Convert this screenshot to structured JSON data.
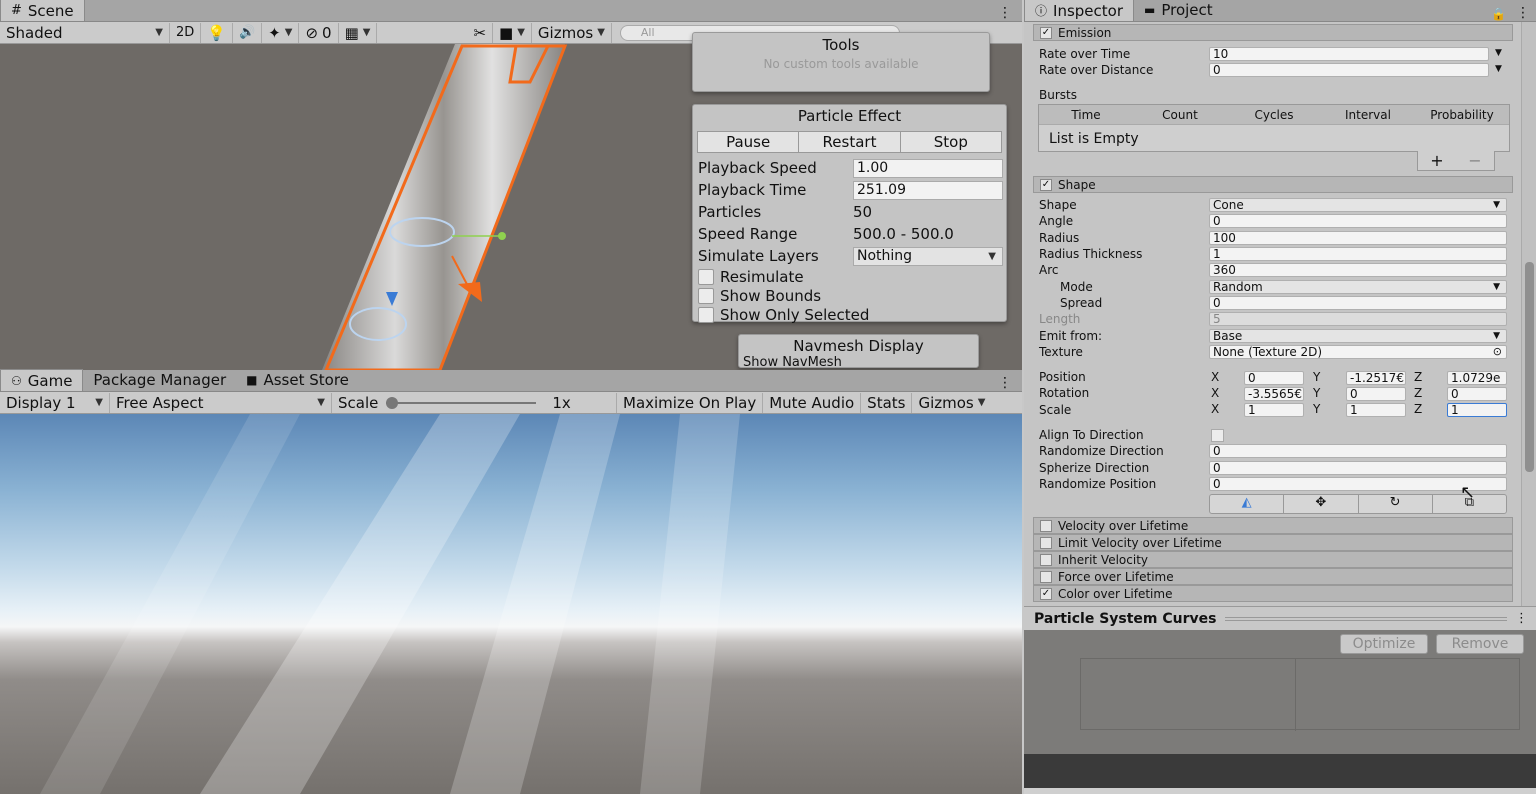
{
  "scene": {
    "tab_label": "Scene",
    "shading_mode": "Shaded",
    "btn_2d": "2D",
    "hidden_count": "0",
    "gizmos_label": "Gizmos",
    "search_placeholder": "All"
  },
  "tools_overlay": {
    "title": "Tools",
    "message": "No custom tools available"
  },
  "particle_effect": {
    "title": "Particle Effect",
    "buttons": {
      "pause": "Pause",
      "restart": "Restart",
      "stop": "Stop"
    },
    "playback_speed_label": "Playback Speed",
    "playback_speed": "1.00",
    "playback_time_label": "Playback Time",
    "playback_time": "251.09",
    "particles_label": "Particles",
    "particles": "50",
    "speed_range_label": "Speed Range",
    "speed_range": "500.0 - 500.0",
    "simulate_layers_label": "Simulate Layers",
    "simulate_layers": "Nothing",
    "resimulate_label": "Resimulate",
    "show_bounds_label": "Show Bounds",
    "show_only_selected_label": "Show Only Selected"
  },
  "navmesh": {
    "title": "Navmesh Display",
    "row": "Show NavMesh"
  },
  "bottom_tabs": {
    "game": "Game",
    "package_manager": "Package Manager",
    "asset_store": "Asset Store"
  },
  "game_toolbar": {
    "display": "Display 1",
    "aspect": "Free Aspect",
    "scale_label": "Scale",
    "scale_value": "1x",
    "scale_fraction": 0.0,
    "maximize": "Maximize On Play",
    "mute": "Mute Audio",
    "stats": "Stats",
    "gizmos": "Gizmos"
  },
  "inspector_tabs": {
    "inspector": "Inspector",
    "project": "Project"
  },
  "emission": {
    "header": "Emission",
    "rate_over_time_label": "Rate over Time",
    "rate_over_time": "10",
    "rate_over_distance_label": "Rate over Distance",
    "rate_over_distance": "0",
    "bursts_label": "Bursts",
    "bursts_columns": [
      "Time",
      "Count",
      "Cycles",
      "Interval",
      "Probability"
    ],
    "bursts_empty": "List is Empty"
  },
  "shape": {
    "header": "Shape",
    "shape_label": "Shape",
    "shape": "Cone",
    "angle_label": "Angle",
    "angle": "0",
    "radius_label": "Radius",
    "radius": "100",
    "radius_thickness_label": "Radius Thickness",
    "radius_thickness": "1",
    "arc_label": "Arc",
    "arc": "360",
    "mode_label": "Mode",
    "mode": "Random",
    "spread_label": "Spread",
    "spread": "0",
    "length_label": "Length",
    "length": "5",
    "emit_from_label": "Emit from:",
    "emit_from": "Base",
    "texture_label": "Texture",
    "texture": "None (Texture 2D)",
    "position_label": "Position",
    "position": {
      "x": "0",
      "y": "-1.2517€",
      "z": "1.0729e"
    },
    "rotation_label": "Rotation",
    "rotation": {
      "x": "-3.5565€",
      "y": "0",
      "z": "0"
    },
    "scale_label": "Scale",
    "scale": {
      "x": "1",
      "y": "1",
      "z": "1"
    },
    "axis_x": "X",
    "axis_y": "Y",
    "axis_z": "Z",
    "align_label": "Align To Direction",
    "rand_dir_label": "Randomize Direction",
    "rand_dir": "0",
    "spherize_label": "Spherize Direction",
    "spherize": "0",
    "rand_pos_label": "Randomize Position",
    "rand_pos": "0"
  },
  "modules": [
    {
      "label": "Velocity over Lifetime",
      "enabled": false
    },
    {
      "label": "Limit Velocity over Lifetime",
      "enabled": false
    },
    {
      "label": "Inherit Velocity",
      "enabled": false
    },
    {
      "label": "Force over Lifetime",
      "enabled": false
    },
    {
      "label": "Color over Lifetime",
      "enabled": true
    }
  ],
  "curves": {
    "title": "Particle System Curves",
    "optimize": "Optimize",
    "remove": "Remove"
  },
  "colors": {
    "selection_outline": "#f26a1b",
    "accent_blue": "#3a7bd5"
  }
}
